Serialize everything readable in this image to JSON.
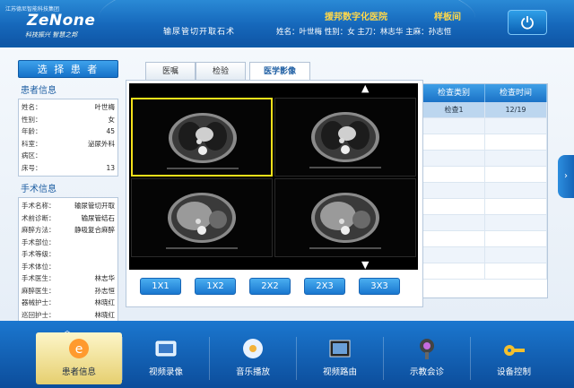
{
  "header": {
    "company": "江苏德尼智能科技集团",
    "logo": "ZeNone",
    "slogan": "科技振兴  智慧之邦",
    "surgery": "输尿管切开取石术",
    "hospital": "援邦数字化医院",
    "room": "样板间",
    "patient_line": "姓名：叶世梅   性别：女   主刀：林志华   主麻：孙志恒",
    "power_icon": "power-icon"
  },
  "left": {
    "select_label": "选 择 患 者",
    "patient_title": "患者信息",
    "patient_info": [
      {
        "k": "姓名：",
        "v": "叶世梅"
      },
      {
        "k": "性别：",
        "v": "女"
      },
      {
        "k": "年龄：",
        "v": "45"
      },
      {
        "k": "科室：",
        "v": "泌尿外科"
      },
      {
        "k": "病区：",
        "v": ""
      },
      {
        "k": "床号：",
        "v": "13"
      }
    ],
    "surgery_title": "手术信息",
    "surgery_info": [
      {
        "k": "手术名称：",
        "v": "输尿管切开取"
      },
      {
        "k": "术前诊断：",
        "v": "输尿管结石"
      },
      {
        "k": "麻醉方法：",
        "v": "静吸复合麻醉"
      },
      {
        "k": "手术部位：",
        "v": ""
      },
      {
        "k": "手术等级：",
        "v": ""
      },
      {
        "k": "手术体位：",
        "v": ""
      },
      {
        "k": "手术医生：",
        "v": "林志华"
      },
      {
        "k": "麻醉医生：",
        "v": "孙志恒"
      },
      {
        "k": "器械护士：",
        "v": "林晓红"
      },
      {
        "k": "巡回护士：",
        "v": "林晓红"
      }
    ]
  },
  "tabs": [
    {
      "label": "医嘱"
    },
    {
      "label": "检验"
    },
    {
      "label": "医学影像"
    }
  ],
  "viewer": {
    "up": "▲",
    "down": "▼",
    "layouts": [
      "1X1",
      "1X2",
      "2X2",
      "2X3",
      "3X3"
    ]
  },
  "exam": {
    "headers": [
      "检查类别",
      "检查时间"
    ],
    "rows": [
      {
        "type": "检查1",
        "time": "12/19"
      }
    ]
  },
  "toolbar": {
    "collapse": "︿",
    "items": [
      {
        "label": "患者信息",
        "icon": "patient-info-icon"
      },
      {
        "label": "视频录像",
        "icon": "video-record-icon"
      },
      {
        "label": "音乐播放",
        "icon": "music-play-icon"
      },
      {
        "label": "视频路由",
        "icon": "video-route-icon"
      },
      {
        "label": "示教会诊",
        "icon": "teaching-consult-icon"
      },
      {
        "label": "设备控制",
        "icon": "device-control-icon"
      }
    ]
  },
  "colors": {
    "accent": "#1b72c6",
    "highlight": "#f4e11a",
    "hospital_text": "#ffd84a"
  }
}
